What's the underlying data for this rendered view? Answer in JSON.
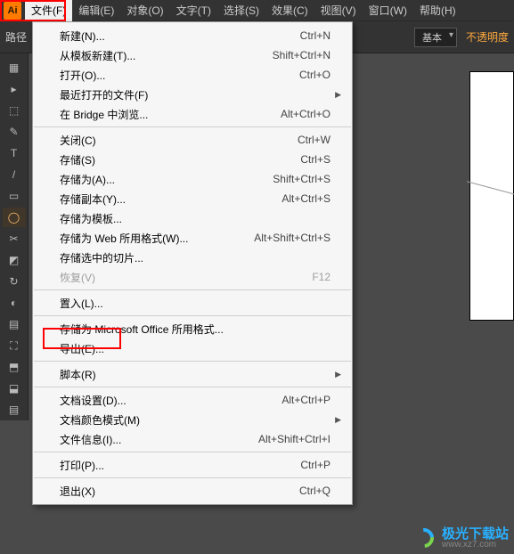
{
  "menubar": {
    "app_icon_text": "Ai",
    "items": [
      "文件(F)",
      "编辑(E)",
      "对象(O)",
      "文字(T)",
      "选择(S)",
      "效果(C)",
      "视图(V)",
      "窗口(W)",
      "帮助(H)"
    ]
  },
  "controlbar": {
    "path_label": "路径",
    "style_dropdown": "基本",
    "opacity_label": "不透明度"
  },
  "tools": [
    "▦",
    "▸",
    "⬚",
    "✎",
    "T",
    "/",
    "▭",
    "◯",
    "✂",
    "◩",
    "↻",
    "◐",
    "▤",
    "⛶",
    "⬒",
    "⬓",
    "▤"
  ],
  "menu": [
    {
      "label": "新建(N)...",
      "shortcut": "Ctrl+N",
      "type": "item"
    },
    {
      "label": "从模板新建(T)...",
      "shortcut": "Shift+Ctrl+N",
      "type": "item"
    },
    {
      "label": "打开(O)...",
      "shortcut": "Ctrl+O",
      "type": "item"
    },
    {
      "label": "最近打开的文件(F)",
      "type": "submenu"
    },
    {
      "label": "在 Bridge 中浏览...",
      "shortcut": "Alt+Ctrl+O",
      "type": "item"
    },
    {
      "type": "sep"
    },
    {
      "label": "关闭(C)",
      "shortcut": "Ctrl+W",
      "type": "item"
    },
    {
      "label": "存储(S)",
      "shortcut": "Ctrl+S",
      "type": "item"
    },
    {
      "label": "存储为(A)...",
      "shortcut": "Shift+Ctrl+S",
      "type": "item"
    },
    {
      "label": "存储副本(Y)...",
      "shortcut": "Alt+Ctrl+S",
      "type": "item"
    },
    {
      "label": "存储为模板...",
      "type": "item"
    },
    {
      "label": "存储为 Web 所用格式(W)...",
      "shortcut": "Alt+Shift+Ctrl+S",
      "type": "item"
    },
    {
      "label": "存储选中的切片...",
      "type": "item"
    },
    {
      "label": "恢复(V)",
      "shortcut": "F12",
      "type": "disabled"
    },
    {
      "type": "sep"
    },
    {
      "label": "置入(L)...",
      "type": "item"
    },
    {
      "type": "sep"
    },
    {
      "label": "存储为 Microsoft Office 所用格式...",
      "type": "item"
    },
    {
      "label": "导出(E)...",
      "type": "item"
    },
    {
      "type": "sep"
    },
    {
      "label": "脚本(R)",
      "type": "submenu"
    },
    {
      "type": "sep"
    },
    {
      "label": "文档设置(D)...",
      "shortcut": "Alt+Ctrl+P",
      "type": "item"
    },
    {
      "label": "文档颜色模式(M)",
      "type": "submenu"
    },
    {
      "label": "文件信息(I)...",
      "shortcut": "Alt+Shift+Ctrl+I",
      "type": "item"
    },
    {
      "type": "sep"
    },
    {
      "label": "打印(P)...",
      "shortcut": "Ctrl+P",
      "type": "item"
    },
    {
      "type": "sep"
    },
    {
      "label": "退出(X)",
      "shortcut": "Ctrl+Q",
      "type": "item"
    }
  ],
  "watermark": {
    "main": "极光下载站",
    "sub": "www.xz7.com"
  }
}
